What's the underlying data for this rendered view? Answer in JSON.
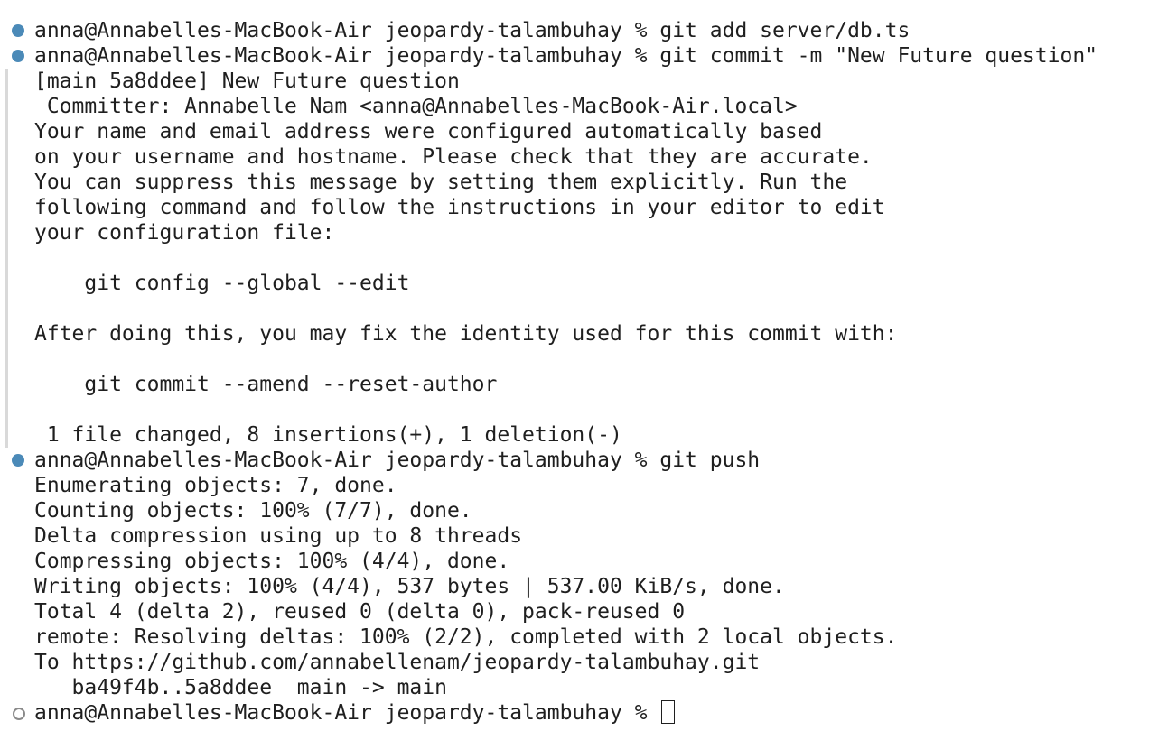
{
  "terminal": {
    "lines": [
      {
        "text": "anna@Annabelles-MacBook-Air jeopardy-talambuhay % git add server/db.ts",
        "marker": "filled"
      },
      {
        "text": "anna@Annabelles-MacBook-Air jeopardy-talambuhay % git commit -m \"New Future question\"",
        "marker": "filled"
      },
      {
        "text": "[main 5a8ddee] New Future question",
        "marker": "bar"
      },
      {
        "text": " Committer: Annabelle Nam <anna@Annabelles-MacBook-Air.local>",
        "marker": "bar"
      },
      {
        "text": "Your name and email address were configured automatically based",
        "marker": "bar"
      },
      {
        "text": "on your username and hostname. Please check that they are accurate.",
        "marker": "bar"
      },
      {
        "text": "You can suppress this message by setting them explicitly. Run the",
        "marker": "bar"
      },
      {
        "text": "following command and follow the instructions in your editor to edit",
        "marker": "bar"
      },
      {
        "text": "your configuration file:",
        "marker": "bar"
      },
      {
        "text": "",
        "marker": "bar"
      },
      {
        "text": "    git config --global --edit",
        "marker": "bar"
      },
      {
        "text": "",
        "marker": "bar"
      },
      {
        "text": "After doing this, you may fix the identity used for this commit with:",
        "marker": "bar"
      },
      {
        "text": "",
        "marker": "bar"
      },
      {
        "text": "    git commit --amend --reset-author",
        "marker": "bar"
      },
      {
        "text": "",
        "marker": "bar"
      },
      {
        "text": " 1 file changed, 8 insertions(+), 1 deletion(-)",
        "marker": "bar"
      },
      {
        "text": "anna@Annabelles-MacBook-Air jeopardy-talambuhay % git push",
        "marker": "filled"
      },
      {
        "text": "Enumerating objects: 7, done.",
        "marker": "none"
      },
      {
        "text": "Counting objects: 100% (7/7), done.",
        "marker": "none"
      },
      {
        "text": "Delta compression using up to 8 threads",
        "marker": "none"
      },
      {
        "text": "Compressing objects: 100% (4/4), done.",
        "marker": "none"
      },
      {
        "text": "Writing objects: 100% (4/4), 537 bytes | 537.00 KiB/s, done.",
        "marker": "none"
      },
      {
        "text": "Total 4 (delta 2), reused 0 (delta 0), pack-reused 0",
        "marker": "none"
      },
      {
        "text": "remote: Resolving deltas: 100% (2/2), completed with 2 local objects.",
        "marker": "none"
      },
      {
        "text": "To https://github.com/annabellenam/jeopardy-talambuhay.git",
        "marker": "none"
      },
      {
        "text": "   ba49f4b..5a8ddee  main -> main",
        "marker": "none"
      },
      {
        "text": "anna@Annabelles-MacBook-Air jeopardy-talambuhay % ",
        "marker": "hollow",
        "cursor": true
      }
    ]
  },
  "colors": {
    "background": "#ffffff",
    "text": "#1f1f1f",
    "success_dot": "#4b8ab8",
    "idle_dot": "#8a8a8a",
    "gutter_bar": "#d9d9d9"
  }
}
